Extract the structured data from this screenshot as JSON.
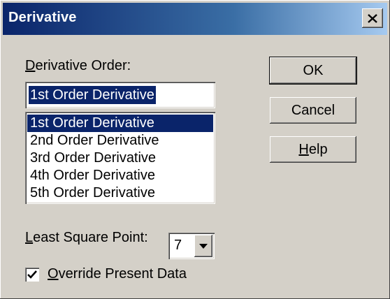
{
  "window": {
    "title": "Derivative",
    "close_glyph": "✕"
  },
  "derivative_order": {
    "label_first": "D",
    "label_rest": "erivative Order:",
    "current_value": "1st Order Derivative",
    "options": [
      "1st Order Derivative",
      "2nd Order Derivative",
      "3rd Order Derivative",
      "4th Order Derivative",
      "5th Order Derivative"
    ],
    "selected_index": 0
  },
  "buttons": {
    "ok": "OK",
    "cancel": "Cancel",
    "help_first": "H",
    "help_rest": "elp"
  },
  "least_square": {
    "label_first": "L",
    "label_rest": "east Square Point:",
    "value": "7"
  },
  "override": {
    "label_first": "O",
    "label_rest": "verride Present Data",
    "checked": true
  },
  "colors": {
    "dialog_face": "#d4d0c8",
    "selection": "#0a246a",
    "title_gradient_start": "#0a246a",
    "title_gradient_end": "#a6caf0"
  }
}
